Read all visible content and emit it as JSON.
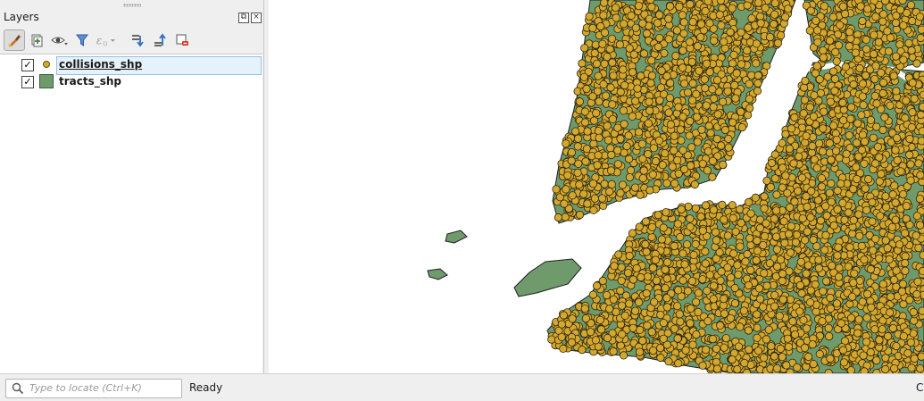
{
  "layers_panel": {
    "title": "Layers",
    "toolbar": [
      {
        "icon": "paintbrush-icon",
        "active": true
      },
      {
        "icon": "add-group-icon"
      },
      {
        "icon": "eye-visibility-icon"
      },
      {
        "icon": "filter-funnel-icon"
      },
      {
        "icon": "expression-filter-icon"
      },
      {
        "icon": "expand-all-icon"
      },
      {
        "icon": "collapse-all-icon"
      },
      {
        "icon": "remove-layer-icon"
      }
    ],
    "layers": [
      {
        "name": "collisions_shp",
        "checked": true,
        "symbol": "point",
        "color": "#d4a82e",
        "selected": true
      },
      {
        "name": "tracts_shp",
        "checked": true,
        "symbol": "polygon",
        "color": "#6f9a6b"
      }
    ]
  },
  "map": {
    "point_color": "#d4a82e",
    "polygon_color": "#6f9a6b",
    "outline_color": "#1f1f1f"
  },
  "statusbar": {
    "locate_placeholder": "Type to locate (Ctrl+K)",
    "status": "Ready",
    "coordinate_label": "Co"
  }
}
